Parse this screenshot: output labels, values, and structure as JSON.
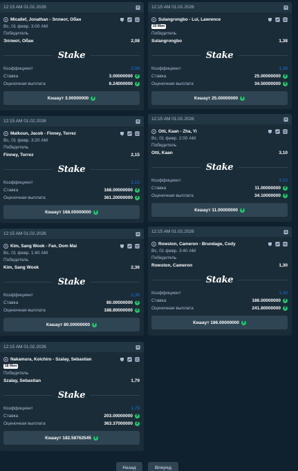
{
  "labels": {
    "market": "Победитель",
    "odds": "Коэффициент",
    "stake": "Ставка",
    "payout": "Оценочная выплата",
    "cashout_prefix": "Кэшаут",
    "logo": "Stake"
  },
  "cards": [
    {
      "timestamp": "12:15 AM 01.02.2026",
      "match": "Micallef, Jonathan - Эллиот, Обан",
      "live_badge": "",
      "date": "Вс, 01 февр.  3:00 AM",
      "outcome": "Эллиот, Обан",
      "outcome_odds": "2,08",
      "odds": "2,08",
      "stake": "3.00000000",
      "payout": "6.24000000",
      "cashout": "Кэшаут 3.00000000"
    },
    {
      "timestamp": "12:15 AM 01.02.2026",
      "match": "Sulangrongbo - Lui, Lawrence",
      "live_badge": "20 Мин",
      "date": "",
      "outcome": "Sulangrongbo",
      "outcome_odds": "1,38",
      "odds": "1,38",
      "stake": "25.00000000",
      "payout": "34.50000000",
      "cashout": "Кэшаут 25.00000000"
    },
    {
      "timestamp": "12:15 AM 01.02.2026",
      "match": "Malkoun, Jacob - Finney, Torrez",
      "live_badge": "",
      "date": "Вс, 01 февр.  3:20 AM",
      "outcome": "Finney, Torrez",
      "outcome_odds": "2,15",
      "odds": "2,15",
      "stake": "168.00000000",
      "payout": "361.20000000",
      "cashout": "Кэшаут 168.00000000"
    },
    {
      "timestamp": "12:15 AM 01.02.2026",
      "match": "Otti, Kaan - Zha, Yi",
      "live_badge": "",
      "date": "Вс, 01 февр.  2:00 AM",
      "outcome": "Otti, Kaan",
      "outcome_odds": "3,10",
      "odds": "3,10",
      "stake": "11.00000000",
      "payout": "34.10000000",
      "cashout": "Кэшаут 11.00000000"
    },
    {
      "timestamp": "12:15 AM 01.02.2026",
      "match": "Kim, Sang Wook - Fan, Dom Mai",
      "live_badge": "",
      "date": "Вс, 01 февр.  1:40 AM",
      "outcome": "Kim, Sang Wook",
      "outcome_odds": "2,36",
      "odds": "2,36",
      "stake": "80.00000000",
      "payout": "188.80000000",
      "cashout": "Кэшаут 80.00000000"
    },
    {
      "timestamp": "12:15 AM 01.02.2026",
      "match": "Rowston, Cameron - Brundage, Cody",
      "live_badge": "",
      "date": "Вс, 01 февр.  3:40 AM",
      "outcome": "Rowston, Cameron",
      "outcome_odds": "1,30",
      "odds": "1,30",
      "stake": "186.00000000",
      "payout": "241.80000000",
      "cashout": "Кэшаут 186.00000000"
    },
    {
      "timestamp": "12:15 AM 01.02.2026",
      "match": "Nakamura, Koichiro - Szalay, Sebastian",
      "live_badge": "58 Мин",
      "date": "",
      "outcome": "Szalay, Sebastian",
      "outcome_odds": "1,79",
      "odds": "1,79",
      "stake": "203.00000000",
      "payout": "363.37000000",
      "cashout": "Кэшаут 182.58762545"
    }
  ],
  "pagination": {
    "prev": "Назад",
    "next": "Вперед"
  },
  "colors": {
    "background": "#0f212e",
    "card": "#1a2c38",
    "odds_blue": "#1475e1",
    "coin_green": "#1fc76a"
  }
}
